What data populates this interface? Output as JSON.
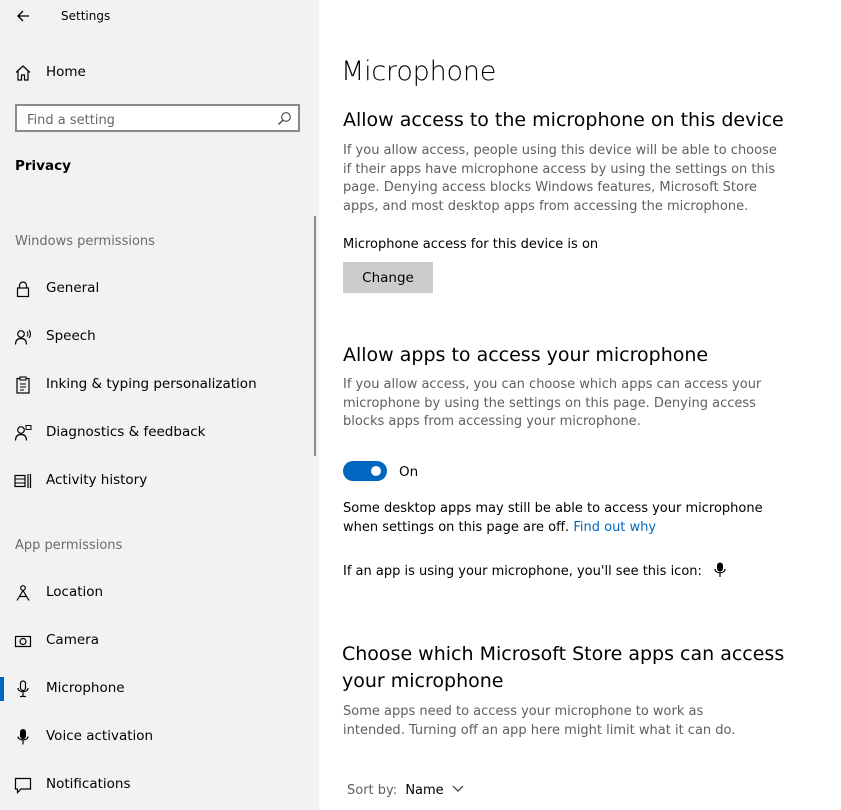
{
  "window": {
    "title": "Settings"
  },
  "sidebar": {
    "home_label": "Home",
    "search_placeholder": "Find a setting",
    "category": "Privacy",
    "windows_permissions_header": "Windows permissions",
    "app_permissions_header": "App permissions",
    "windows_items": [
      {
        "label": "General",
        "icon": "lock-icon"
      },
      {
        "label": "Speech",
        "icon": "speech-icon"
      },
      {
        "label": "Inking & typing personalization",
        "icon": "clipboard-icon"
      },
      {
        "label": "Diagnostics & feedback",
        "icon": "feedback-icon"
      },
      {
        "label": "Activity history",
        "icon": "activity-icon"
      }
    ],
    "app_items": [
      {
        "label": "Location",
        "icon": "location-icon"
      },
      {
        "label": "Camera",
        "icon": "camera-icon"
      },
      {
        "label": "Microphone",
        "icon": "microphone-icon",
        "selected": true
      },
      {
        "label": "Voice activation",
        "icon": "voice-mic-icon"
      },
      {
        "label": "Notifications",
        "icon": "notifications-icon"
      }
    ]
  },
  "main": {
    "page_title": "Microphone",
    "device_section": {
      "heading": "Allow access to the microphone on this device",
      "description": "If you allow access, people using this device will be able to choose if their apps have microphone access by using the settings on this page. Denying access blocks Windows features, Microsoft Store apps, and most desktop apps from accessing the microphone.",
      "status": "Microphone access for this device is on",
      "change_label": "Change"
    },
    "apps_section": {
      "heading": "Allow apps to access your microphone",
      "description": "If you allow access, you can choose which apps can access your microphone by using the settings on this page. Denying access blocks apps from accessing your microphone.",
      "toggle_state": "On",
      "note": "Some desktop apps may still be able to access your microphone when settings on this page are off.",
      "link": "Find out why",
      "icon_note": "If an app is using your microphone, you'll see this icon:"
    },
    "store_section": {
      "heading": "Choose which Microsoft Store apps can access your microphone",
      "description": "Some apps need to access your microphone to work as intended. Turning off an app here might limit what it can do.",
      "sort_label": "Sort by:",
      "sort_value": "Name"
    }
  },
  "colors": {
    "accent": "#0067c0",
    "sidebar_bg": "#f2f2f2",
    "secondary_text": "#5f5f5f"
  }
}
